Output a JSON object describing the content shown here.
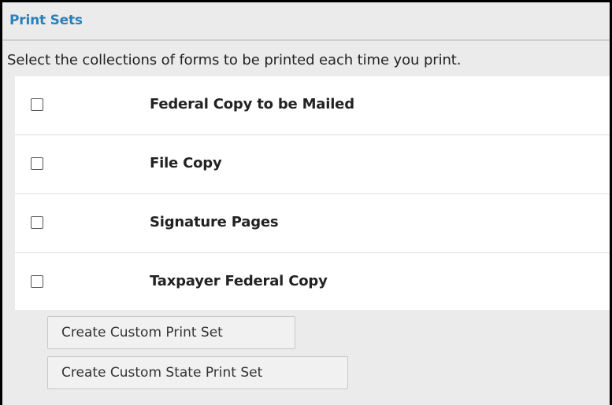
{
  "panel": {
    "title": "Print Sets",
    "description": "Select the collections of forms to be printed each time you print."
  },
  "print_sets": [
    {
      "label": "Federal Copy to be Mailed",
      "checked": false
    },
    {
      "label": "File Copy",
      "checked": false
    },
    {
      "label": "Signature Pages",
      "checked": false
    },
    {
      "label": "Taxpayer Federal Copy",
      "checked": false
    }
  ],
  "buttons": {
    "create_custom": "Create Custom Print Set",
    "create_custom_state": "Create Custom State Print Set"
  },
  "colors": {
    "title": "#2c80b9",
    "header_bg": "#ebebeb",
    "list_bg": "#ffffff"
  }
}
